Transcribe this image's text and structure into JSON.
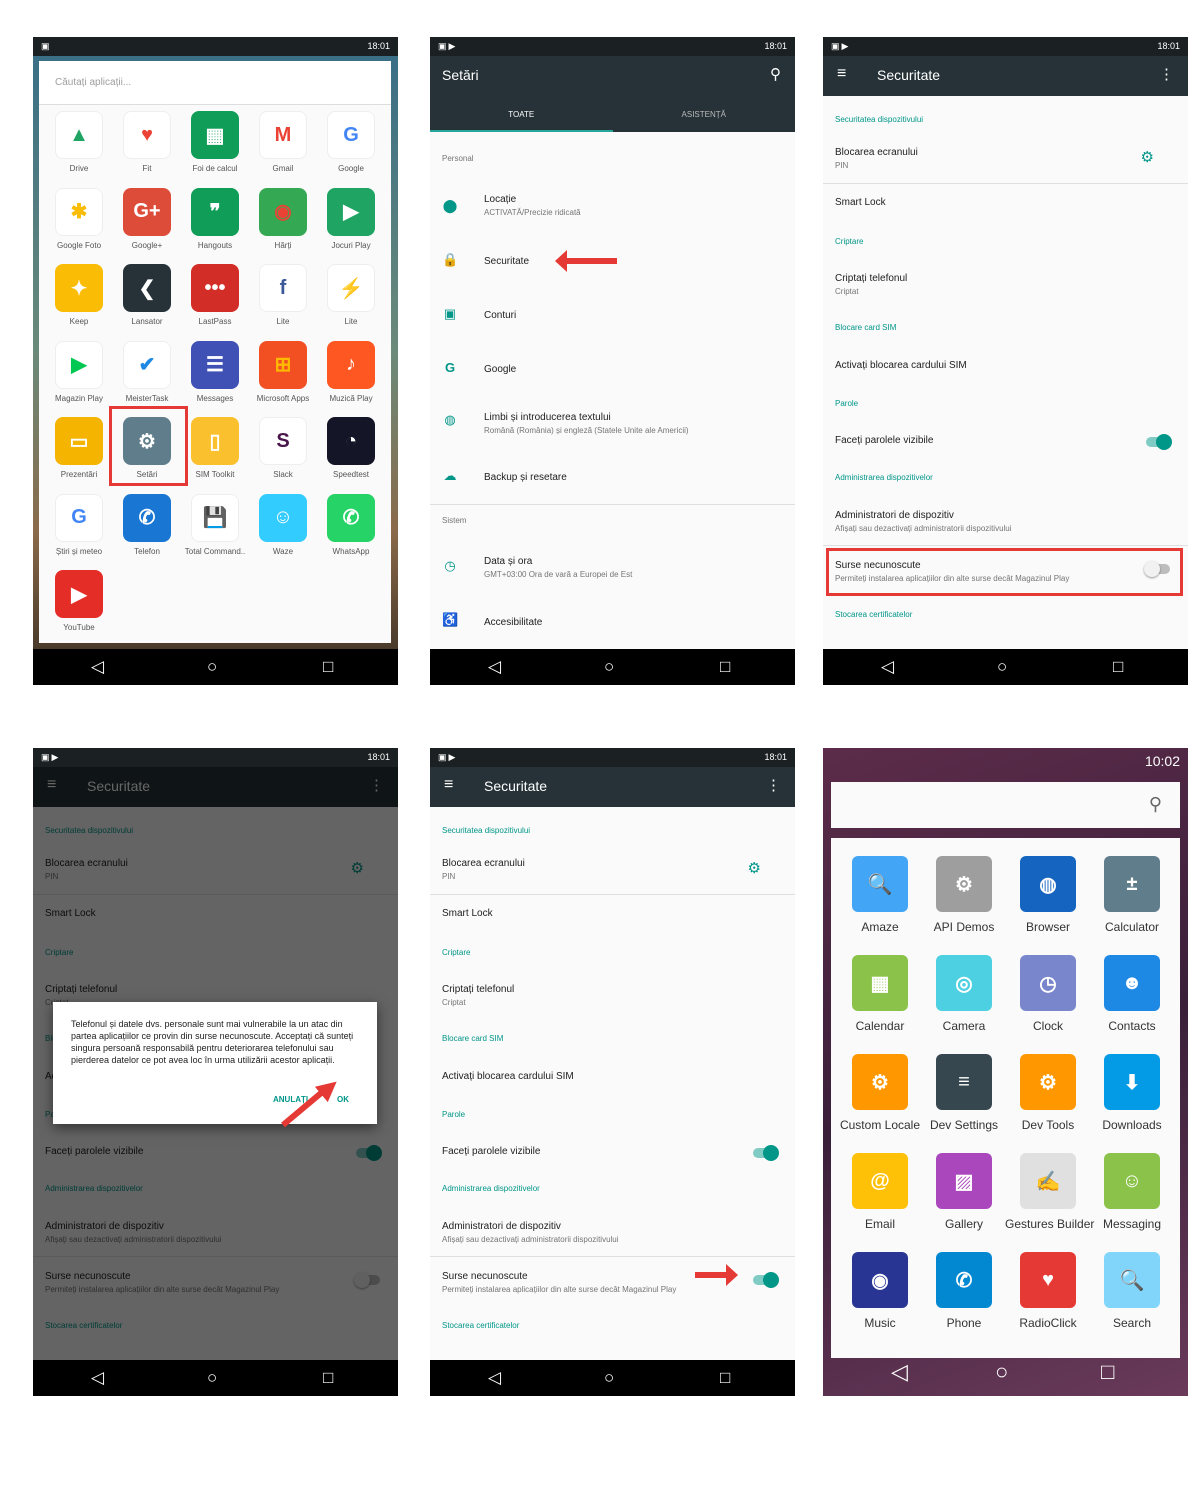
{
  "status_time": "18:01",
  "status_time2": "10:02",
  "phone1": {
    "search_placeholder": "Căutați aplicații...",
    "apps": [
      {
        "label": "Drive",
        "icon": "drive-icon",
        "color": "#ffffff",
        "glyph": "▲",
        "fg": "#1fa463"
      },
      {
        "label": "Fit",
        "icon": "fit-icon",
        "color": "#ffffff",
        "glyph": "♥",
        "fg": "#ea4335"
      },
      {
        "label": "Foi de calcul",
        "icon": "sheets-icon",
        "color": "#0f9d58",
        "glyph": "▦",
        "fg": "#ffffff"
      },
      {
        "label": "Gmail",
        "icon": "gmail-icon",
        "color": "#ffffff",
        "glyph": "M",
        "fg": "#ea4335"
      },
      {
        "label": "Google",
        "icon": "google-icon",
        "color": "#ffffff",
        "glyph": "G",
        "fg": "#4285f4"
      },
      {
        "label": "Google Foto",
        "icon": "photos-icon",
        "color": "#ffffff",
        "glyph": "✱",
        "fg": "#fbbc05"
      },
      {
        "label": "Google+",
        "icon": "google-plus-icon",
        "color": "#dd4b39",
        "glyph": "G+",
        "fg": "#ffffff"
      },
      {
        "label": "Hangouts",
        "icon": "hangouts-icon",
        "color": "#0f9d58",
        "glyph": "❞",
        "fg": "#ffffff"
      },
      {
        "label": "Hărți",
        "icon": "maps-icon",
        "color": "#34a853",
        "glyph": "◉",
        "fg": "#ea4335"
      },
      {
        "label": "Jocuri Play",
        "icon": "play-games-icon",
        "color": "#1fa463",
        "glyph": "▶",
        "fg": "#ffffff"
      },
      {
        "label": "Keep",
        "icon": "keep-icon",
        "color": "#fbbc05",
        "glyph": "✦",
        "fg": "#ffffff"
      },
      {
        "label": "Lansator",
        "icon": "launcher-icon",
        "color": "#263238",
        "glyph": "❮",
        "fg": "#ffffff"
      },
      {
        "label": "LastPass",
        "icon": "lastpass-icon",
        "color": "#d32d27",
        "glyph": "•••",
        "fg": "#ffffff"
      },
      {
        "label": "Lite",
        "icon": "facebook-lite-icon",
        "color": "#ffffff",
        "glyph": "f",
        "fg": "#3b5998"
      },
      {
        "label": "Lite",
        "icon": "messenger-lite-icon",
        "color": "#ffffff",
        "glyph": "⚡",
        "fg": "#0084ff"
      },
      {
        "label": "Magazin Play",
        "icon": "play-store-icon",
        "color": "#ffffff",
        "glyph": "▶",
        "fg": "#00c853"
      },
      {
        "label": "MeisterTask",
        "icon": "meistertask-icon",
        "color": "#ffffff",
        "glyph": "✔",
        "fg": "#1e88e5"
      },
      {
        "label": "Messages",
        "icon": "messages-icon",
        "color": "#3f51b5",
        "glyph": "☰",
        "fg": "#ffffff"
      },
      {
        "label": "Microsoft Apps",
        "icon": "microsoft-apps-icon",
        "color": "#f25022",
        "glyph": "⊞",
        "fg": "#ffb900"
      },
      {
        "label": "Muzică Play",
        "icon": "play-music-icon",
        "color": "#ff5722",
        "glyph": "♪",
        "fg": "#ffffff"
      },
      {
        "label": "Prezentări",
        "icon": "slides-icon",
        "color": "#f4b400",
        "glyph": "▭",
        "fg": "#ffffff"
      },
      {
        "label": "Setări",
        "icon": "settings-icon",
        "color": "#607d8b",
        "glyph": "⚙",
        "fg": "#ffffff"
      },
      {
        "label": "SIM Toolkit",
        "icon": "sim-toolkit-icon",
        "color": "#fbc02d",
        "glyph": "▯",
        "fg": "#ffffff"
      },
      {
        "label": "Slack",
        "icon": "slack-icon",
        "color": "#ffffff",
        "glyph": "S",
        "fg": "#4a154b"
      },
      {
        "label": "Speedtest",
        "icon": "speedtest-icon",
        "color": "#141526",
        "glyph": "◔",
        "fg": "#ffffff"
      },
      {
        "label": "Știri și meteo",
        "icon": "news-weather-icon",
        "color": "#ffffff",
        "glyph": "G",
        "fg": "#4285f4"
      },
      {
        "label": "Telefon",
        "icon": "phone-icon",
        "color": "#1976d2",
        "glyph": "✆",
        "fg": "#ffffff"
      },
      {
        "label": "Total Command..",
        "icon": "total-commander-icon",
        "color": "#ffffff",
        "glyph": "💾",
        "fg": "#c62828"
      },
      {
        "label": "Waze",
        "icon": "waze-icon",
        "color": "#33ccff",
        "glyph": "☺",
        "fg": "#ffffff"
      },
      {
        "label": "WhatsApp",
        "icon": "whatsapp-icon",
        "color": "#25d366",
        "glyph": "✆",
        "fg": "#ffffff"
      },
      {
        "label": "YouTube",
        "icon": "youtube-icon",
        "color": "#e52d27",
        "glyph": "▶",
        "fg": "#ffffff"
      }
    ]
  },
  "phone2": {
    "title": "Setări",
    "tab_all": "TOATE",
    "tab_help": "ASISTENȚĂ",
    "section_personal": "Personal",
    "section_system": "Sistem",
    "location": "Locație",
    "location_sub": "ACTIVATĂ/Precizie ridicată",
    "security": "Securitate",
    "accounts": "Conturi",
    "google": "Google",
    "languages": "Limbi și introducerea textului",
    "languages_sub": "Română (România) și engleză (Statele Unite ale Americii)",
    "backup": "Backup și resetare",
    "datetime": "Data și ora",
    "datetime_sub": "GMT+03:00 Ora de vară a Europei de Est",
    "accessibility": "Accesibilitate"
  },
  "security": {
    "title": "Securitate",
    "sec_device": "Securitatea dispozitivului",
    "screen_lock": "Blocarea ecranului",
    "screen_lock_sub": "PIN",
    "smart_lock": "Smart Lock",
    "sec_encryption": "Criptare",
    "encrypt": "Criptați telefonul",
    "encrypt_sub": "Criptat",
    "sec_sim": "Blocare card SIM",
    "sim_lock": "Activați blocarea cardului SIM",
    "sec_passwords": "Parole",
    "show_passwords": "Faceți parolele vizibile",
    "sec_admin": "Administrarea dispozitivelor",
    "admins": "Administratori de dispozitiv",
    "admins_sub": "Afișați sau dezactivați administratorii dispozitivului",
    "unknown": "Surse necunoscute",
    "unknown_sub": "Permiteți instalarea aplicațiilor din alte surse decât Magazinul Play",
    "sec_certs": "Stocarea certificatelor"
  },
  "dialog": {
    "message": "Telefonul și datele dvs. personale sunt mai vulnerabile la un atac din partea aplicațiilor ce provin din surse necunoscute. Acceptați că sunteți singura persoană responsabilă pentru deteriorarea telefonului sau pierderea datelor ce pot avea loc în urma utilizării acestor aplicații.",
    "cancel": "ANULAȚI",
    "ok": "OK"
  },
  "phone6": {
    "apps": [
      {
        "label": "Amaze",
        "icon": "amaze-icon",
        "color": "#42a5f5",
        "glyph": "🔍"
      },
      {
        "label": "API Demos",
        "icon": "api-demos-icon",
        "color": "#9e9e9e",
        "glyph": "⚙"
      },
      {
        "label": "Browser",
        "icon": "browser-icon",
        "color": "#1565c0",
        "glyph": "◍"
      },
      {
        "label": "Calculator",
        "icon": "calculator-icon",
        "color": "#607d8b",
        "glyph": "±"
      },
      {
        "label": "Calendar",
        "icon": "calendar-icon",
        "color": "#8bc34a",
        "glyph": "▦"
      },
      {
        "label": "Camera",
        "icon": "camera-icon",
        "color": "#4dd0e1",
        "glyph": "◎"
      },
      {
        "label": "Clock",
        "icon": "clock-icon",
        "color": "#7986cb",
        "glyph": "◷"
      },
      {
        "label": "Contacts",
        "icon": "contacts-icon",
        "color": "#1e88e5",
        "glyph": "☻"
      },
      {
        "label": "Custom Locale",
        "icon": "custom-locale-icon",
        "color": "#ff9800",
        "glyph": "⚙"
      },
      {
        "label": "Dev Settings",
        "icon": "dev-settings-icon",
        "color": "#37474f",
        "glyph": "≡"
      },
      {
        "label": "Dev Tools",
        "icon": "dev-tools-icon",
        "color": "#ff9800",
        "glyph": "⚙"
      },
      {
        "label": "Downloads",
        "icon": "downloads-icon",
        "color": "#039be5",
        "glyph": "⬇"
      },
      {
        "label": "Email",
        "icon": "email-icon",
        "color": "#ffc107",
        "glyph": "@"
      },
      {
        "label": "Gallery",
        "icon": "gallery-icon",
        "color": "#ab47bc",
        "glyph": "▨"
      },
      {
        "label": "Gestures Builder",
        "icon": "gestures-builder-icon",
        "color": "#e0e0e0",
        "glyph": "✍"
      },
      {
        "label": "Messaging",
        "icon": "messaging-icon",
        "color": "#8bc34a",
        "glyph": "☺"
      },
      {
        "label": "Music",
        "icon": "music-icon",
        "color": "#283593",
        "glyph": "◉"
      },
      {
        "label": "Phone",
        "icon": "phone-icon",
        "color": "#0288d1",
        "glyph": "✆"
      },
      {
        "label": "RadioClick",
        "icon": "radioclick-icon",
        "color": "#e53935",
        "glyph": "♥"
      },
      {
        "label": "Search",
        "icon": "search-icon",
        "color": "#81d4fa",
        "glyph": "🔍"
      }
    ]
  },
  "colors": {
    "accent": "#009688",
    "toolbar": "#263238",
    "highlight": "#e53935"
  }
}
